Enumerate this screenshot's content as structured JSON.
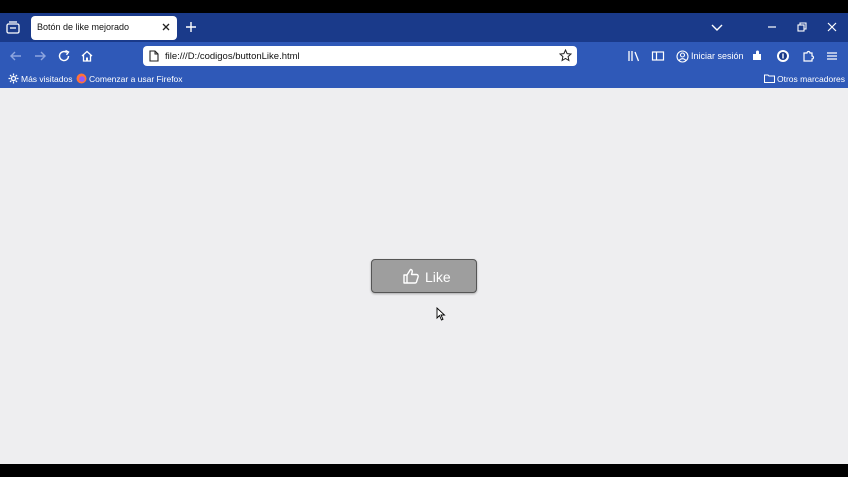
{
  "tab": {
    "title": "Botón de like mejorado"
  },
  "urlbar": {
    "url": "file:///D:/codigos/buttonLike.html"
  },
  "account": {
    "signin_label": "Iniciar sesión"
  },
  "bookmarks": {
    "most_visited": "Más visitados",
    "getting_started": "Comenzar a usar Firefox",
    "other_bookmarks": "Otros marcadores"
  },
  "content": {
    "like_label": "Like"
  },
  "colors": {
    "tabstrip": "#1a3a8a",
    "toolbar": "#2f59b8",
    "page_background": "#eeeef0",
    "button_background": "#9e9e9e"
  },
  "icons": [
    "tab-list-icon",
    "close-icon",
    "plus-icon",
    "chevron-down-icon",
    "minimize-icon",
    "restore-icon",
    "window-close-icon",
    "back-arrow-icon",
    "forward-arrow-icon",
    "reload-icon",
    "home-icon",
    "page-icon",
    "star-icon",
    "library-icon",
    "sidebar-icon",
    "account-icon",
    "extension-puzzle-icon",
    "menu-icon",
    "gear-icon",
    "firefox-logo-icon",
    "folder-icon",
    "thumbs-up-icon",
    "mouse-cursor-icon"
  ]
}
